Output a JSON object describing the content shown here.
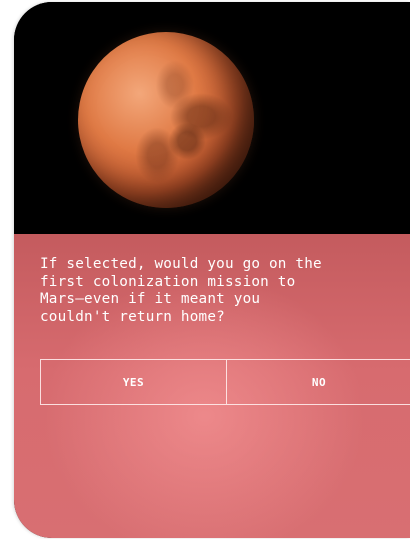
{
  "card": {
    "question": "If selected, would you go on the\nfirst colonization mission to\nMars—even if it meant you\ncouldn't return home?",
    "options": [
      {
        "label": "YES"
      },
      {
        "label": "NO"
      }
    ]
  },
  "colors": {
    "panel_top": "#c45b5e",
    "panel_bottom": "#d86f72",
    "text": "#ffffff"
  },
  "icons": {
    "hero_image": "mars-planet"
  }
}
